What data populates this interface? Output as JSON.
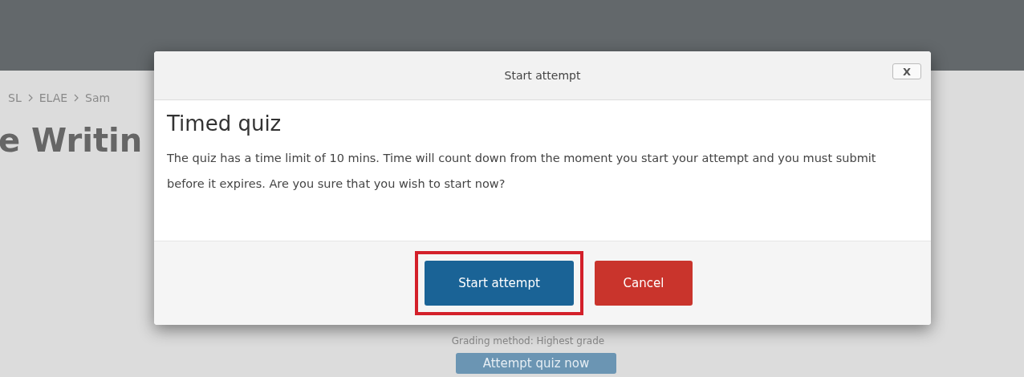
{
  "page": {
    "breadcrumb": [
      "SL",
      "ELAE",
      "Sam"
    ],
    "heading": "e Writin",
    "grading": "Grading method: Highest grade",
    "attempt_button": "Attempt quiz now"
  },
  "dialog": {
    "title": "Start attempt",
    "close": "X",
    "heading": "Timed quiz",
    "message": "The quiz has a time limit of 10 mins. Time will count down from the moment you start your attempt and you must submit before it expires. Are you sure that you wish to start now?",
    "buttons": [
      {
        "label": "Start attempt",
        "kind": "primary",
        "highlighted": true
      },
      {
        "label": "Cancel",
        "kind": "danger",
        "highlighted": false
      }
    ]
  }
}
